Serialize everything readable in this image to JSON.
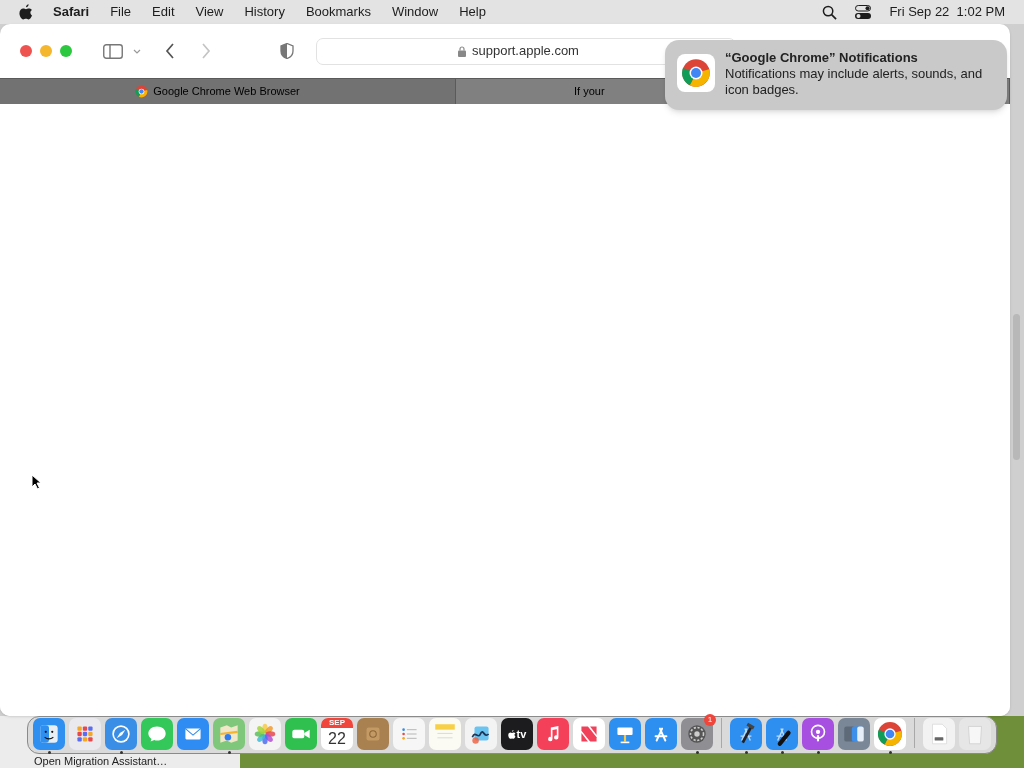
{
  "menu_bar": {
    "app_name": "Safari",
    "menus": [
      "File",
      "Edit",
      "View",
      "History",
      "Bookmarks",
      "Window",
      "Help"
    ],
    "clock": "Fri Sep 22  1:02 PM"
  },
  "browser": {
    "address": "support.apple.com",
    "back_enabled": true,
    "forward_enabled": false,
    "tabs": [
      {
        "label": "Google Chrome Web Browser",
        "selected": true,
        "favicon": true
      },
      {
        "label": "If your",
        "selected": false,
        "favicon": false
      }
    ]
  },
  "notification": {
    "title": "“Google Chrome” Notifications",
    "body": "Notifications may include alerts, sounds, and icon badges."
  },
  "background_window": {
    "text": "Open Migration Assistant…"
  },
  "dock": [
    {
      "kind": "face",
      "color": "#2e8ff0",
      "running": true
    },
    {
      "kind": "grid",
      "color": "#e9e9ee",
      "running": false
    },
    {
      "kind": "compass",
      "color": "#3a8ee6",
      "running": true
    },
    {
      "kind": "bubble",
      "color": "#34c759",
      "running": false
    },
    {
      "kind": "envelope",
      "color": "#2f8cf2",
      "running": false
    },
    {
      "kind": "map",
      "color": "#7fc77a",
      "running": true
    },
    {
      "kind": "flower",
      "color": "#f4f4f4",
      "running": false
    },
    {
      "kind": "camera",
      "color": "#30c04f",
      "running": false
    },
    {
      "kind": "calendar",
      "color": "#ffffff",
      "running": false,
      "month": "SEP",
      "day": "22"
    },
    {
      "kind": "box",
      "color": "#a9804f",
      "running": false
    },
    {
      "kind": "list",
      "color": "#f6f6f6",
      "running": false
    },
    {
      "kind": "notepad",
      "color": "#fbfbf3",
      "running": false
    },
    {
      "kind": "scribble",
      "color": "#f3f3f3",
      "running": false
    },
    {
      "kind": "tv",
      "color": "#1c1c1e",
      "running": false,
      "label": "tv"
    },
    {
      "kind": "music",
      "color": "#f5405a",
      "running": false
    },
    {
      "kind": "news",
      "color": "#ffffff",
      "running": false
    },
    {
      "kind": "podium",
      "color": "#2d8ff0",
      "running": false
    },
    {
      "kind": "store",
      "color": "#2d8ff0",
      "running": false
    },
    {
      "kind": "gear",
      "color": "#8e8e93",
      "running": true,
      "badge": "1"
    },
    {
      "kind": "separator"
    },
    {
      "kind": "hammer",
      "color": "#2e8ff0",
      "running": true
    },
    {
      "kind": "wrench",
      "color": "#2e8ff0",
      "running": true
    },
    {
      "kind": "podcast",
      "color": "#a74fe0",
      "running": true
    },
    {
      "kind": "migration",
      "color": "#7a8796",
      "running": false
    },
    {
      "kind": "chrome",
      "color": "#ffffff",
      "running": true
    },
    {
      "kind": "separator"
    },
    {
      "kind": "drive",
      "color": "#f2f2f2",
      "running": false
    },
    {
      "kind": "trash",
      "color": "#e6e6e6",
      "running": false
    }
  ]
}
